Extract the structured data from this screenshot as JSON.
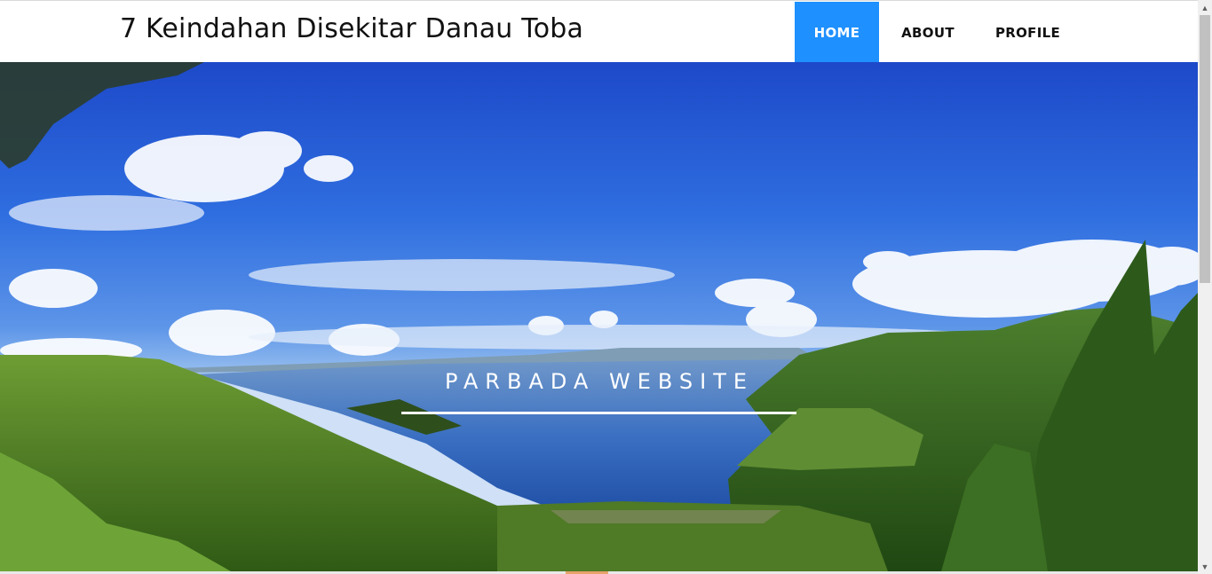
{
  "header": {
    "site_title": "7 Keindahan Disekitar Danau Toba",
    "nav": [
      {
        "label": "HOME",
        "active": true
      },
      {
        "label": "ABOUT",
        "active": false
      },
      {
        "label": "PROFILE",
        "active": false
      }
    ],
    "accent_color": "#1e90ff"
  },
  "hero": {
    "title": "PARBADA WEBSITE",
    "image": "lake-toba-landscape"
  },
  "scrollbar": {
    "up_icon": "triangle-up-icon",
    "down_icon": "triangle-down-icon"
  }
}
